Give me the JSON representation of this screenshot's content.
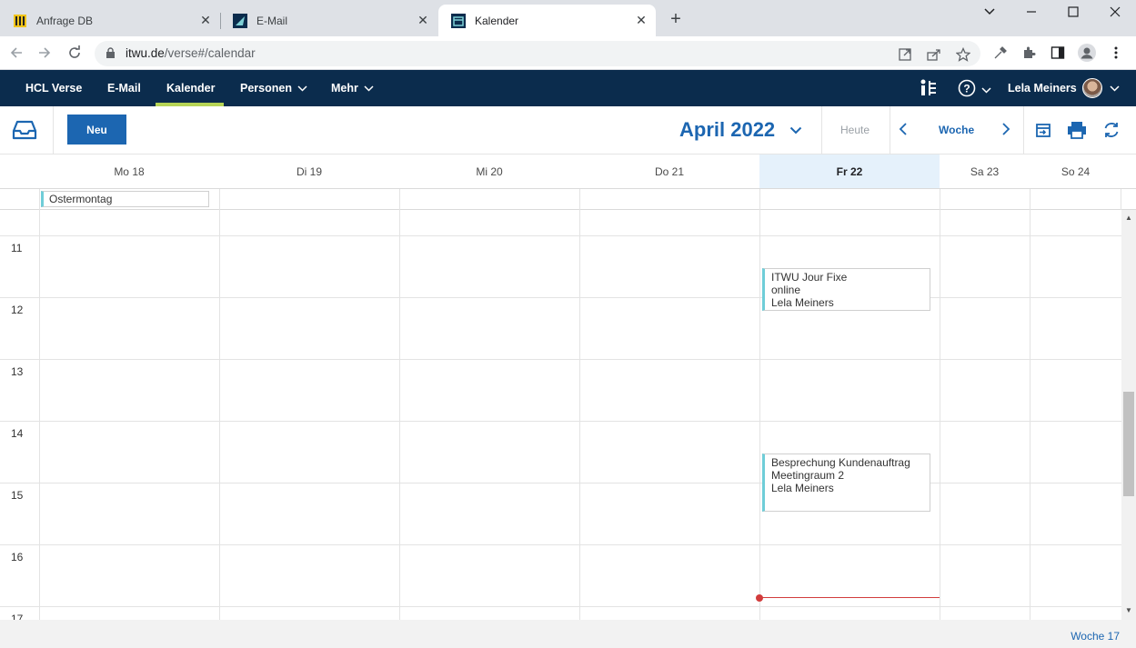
{
  "browser": {
    "tabs": [
      {
        "title": "Anfrage DB",
        "icon": "database-app-icon",
        "active": false
      },
      {
        "title": "E-Mail",
        "icon": "mail-app-icon",
        "active": false
      },
      {
        "title": "Kalender",
        "icon": "calendar-app-icon",
        "active": true
      }
    ],
    "new_tab": "+",
    "url_host": "itwu.de",
    "url_path": "/verse#/calendar"
  },
  "app_nav": {
    "items": [
      {
        "label": "HCL Verse"
      },
      {
        "label": "E-Mail"
      },
      {
        "label": "Kalender"
      },
      {
        "label": "Personen"
      },
      {
        "label": "Mehr"
      }
    ],
    "user_name": "Lela Meiners",
    "accent": "#b6d455",
    "bg": "#0b2c4d"
  },
  "toolbar": {
    "new_label": "Neu",
    "month_label": "April 2022",
    "today_label": "Heute",
    "view_label": "Woche"
  },
  "days": [
    {
      "label": "Mo 18",
      "today": false
    },
    {
      "label": "Di 19",
      "today": false
    },
    {
      "label": "Mi 20",
      "today": false
    },
    {
      "label": "Do 21",
      "today": false
    },
    {
      "label": "Fr 22",
      "today": true
    },
    {
      "label": "Sa 23",
      "today": false
    },
    {
      "label": "So 24",
      "today": false
    }
  ],
  "allday_events": [
    {
      "title": "Ostermontag",
      "day": "Mo 18"
    }
  ],
  "hours": [
    "11",
    "12",
    "13",
    "14",
    "15",
    "16",
    "17"
  ],
  "events": [
    {
      "day": "Fr 22",
      "title": "ITWU Jour Fixe",
      "location": "online",
      "owner": "Lela Meiners"
    },
    {
      "day": "Fr 22",
      "title": "Besprechung Kundenauftrag",
      "location": "Meetingraum 2",
      "owner": "Lela Meiners"
    }
  ],
  "footer": {
    "week_label": "Woche 17"
  },
  "colors": {
    "primary": "#1c66b1",
    "today_bg": "#e5f1fb",
    "event_bar": "#6fcdd8",
    "now_line": "#d23c3c"
  }
}
